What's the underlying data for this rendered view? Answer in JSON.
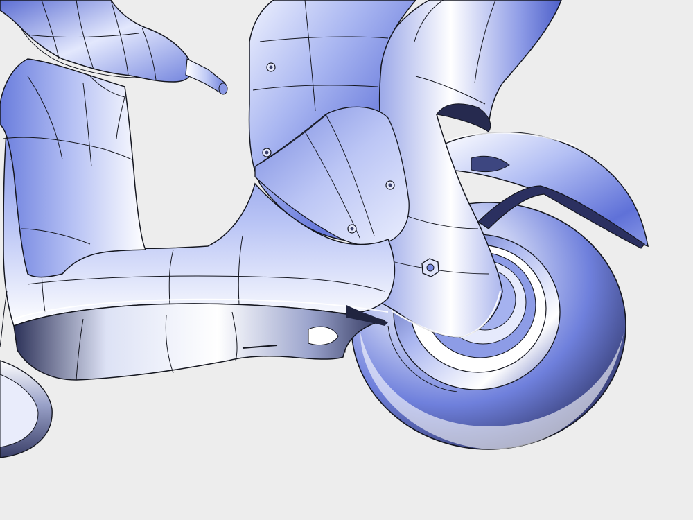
{
  "scene": {
    "subject": "scooter-cad-model",
    "background_color": "#ededed",
    "colors": {
      "highlight": "#ffffff",
      "light": "#c9d2f6",
      "mid": "#8f9eea",
      "deep": "#5b6ed6",
      "shadow": "#2a2f5a",
      "edge": "#14161f"
    }
  }
}
